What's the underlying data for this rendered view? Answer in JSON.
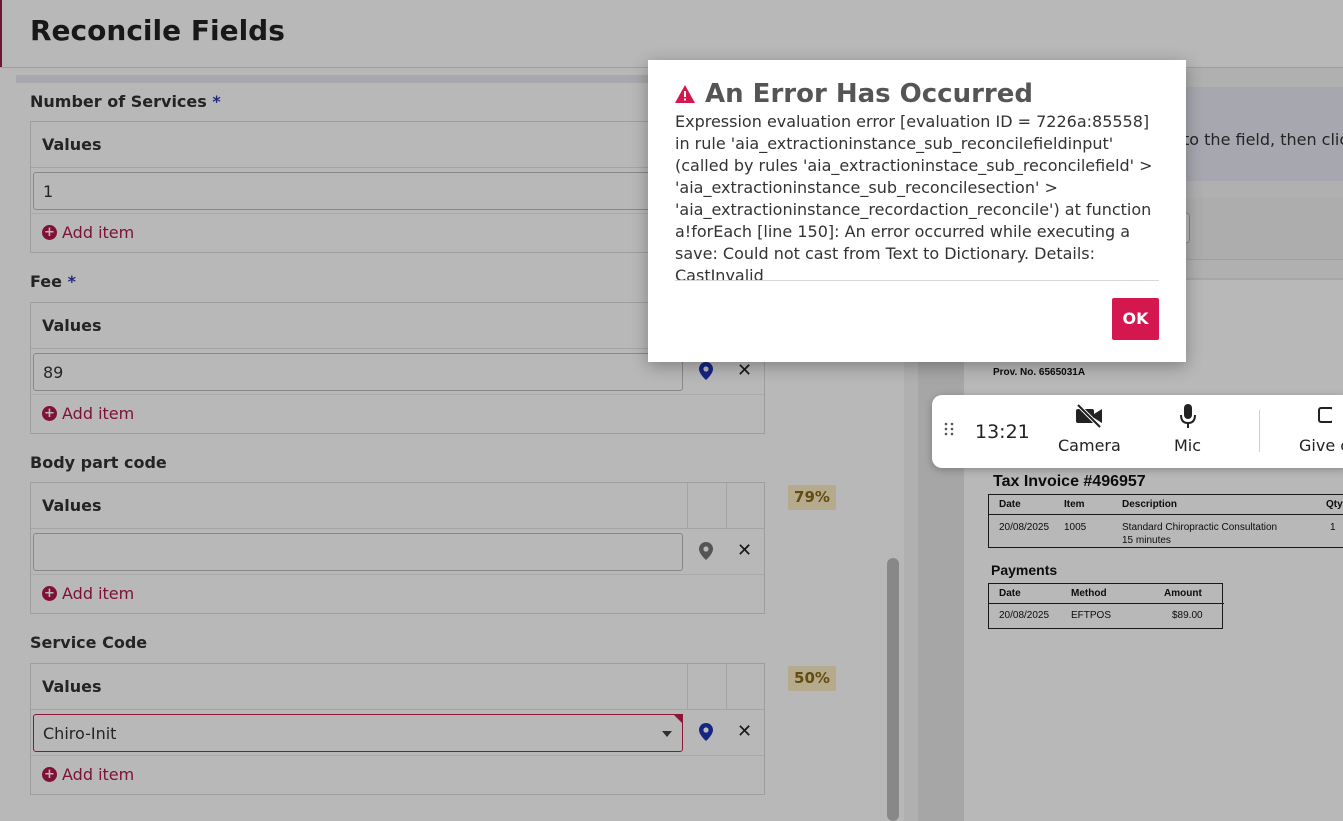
{
  "page": {
    "title": "Reconcile Fields"
  },
  "sections": [
    {
      "label": "Number of Services",
      "required_mark": "*",
      "values_header": "Values",
      "value": "1",
      "add_label": "Add item"
    },
    {
      "label": "Fee",
      "required_mark": "*",
      "values_header": "Values",
      "value": "89",
      "add_label": "Add item"
    },
    {
      "label": "Body part code",
      "required_mark": "",
      "values_header": "Values",
      "value": "",
      "add_label": "Add item",
      "confidence": "79%"
    },
    {
      "label": "Service Code",
      "required_mark": "",
      "values_header": "Values",
      "value": "Chiro-Init",
      "add_label": "Add item",
      "confidence": "50%"
    }
  ],
  "instructions": {
    "visible_text": "to the field, then click,"
  },
  "document": {
    "prov_no": "Prov. No. 6565031A",
    "invoice_title": "Tax Invoice #496957",
    "items_headers": [
      "Date",
      "Item",
      "Description",
      "Qty"
    ],
    "items_row": [
      "20/08/2025",
      "1005",
      "Standard Chiropractic Consultation",
      "1"
    ],
    "items_row_line2": "15 minutes",
    "payments_title": "Payments",
    "payments_headers": [
      "Date",
      "Method",
      "Amount"
    ],
    "payments_row": [
      "20/08/2025",
      "EFTPOS",
      "$89.00"
    ]
  },
  "call_bar": {
    "time": "13:21",
    "camera_label": "Camera",
    "mic_label": "Mic",
    "give_label": "Give c"
  },
  "dialog": {
    "title": "An Error Has Occurred",
    "message": "Expression evaluation error [evaluation ID = 7226a:85558] in rule 'aia_extractioninstance_sub_reconcilefieldinput' (called by rules 'aia_extractioninstace_sub_reconcilefield' > 'aia_extractioninstance_sub_reconcilesection' > 'aia_extractioninstance_recordaction_reconcile') at function a!forEach [line 150]: An error occurred while executing a save: Could not cast from Text to Dictionary. Details: CastInvalid",
    "ok_label": "OK"
  },
  "colors": {
    "accent": "#d4174f",
    "link": "#b0184a",
    "pin_active": "#2233b8",
    "pin_inactive": "#777777",
    "badge_bg": "#fbecc3"
  }
}
